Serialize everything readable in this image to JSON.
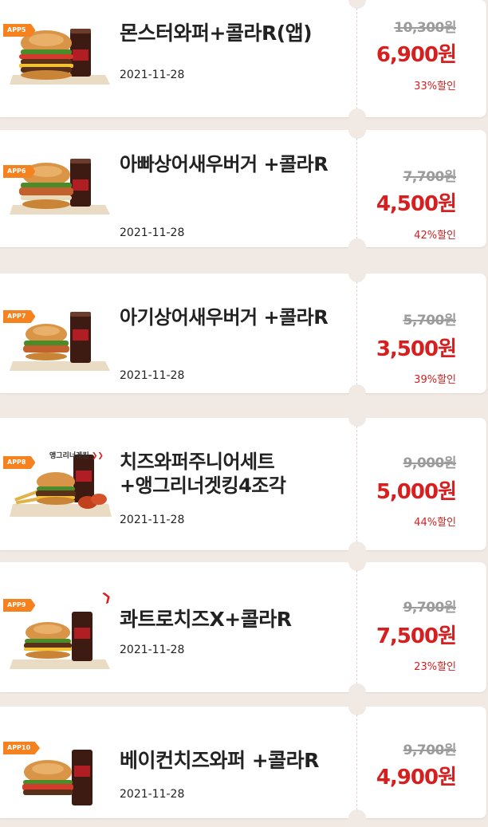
{
  "coupons": [
    {
      "badge": "APP5",
      "promo_tag": "",
      "name": "몬스터와퍼+콜라R(앱)",
      "date": "2021-11-28",
      "original_price": "10,300원",
      "sale_price": "6,900원",
      "discount": "33%할인"
    },
    {
      "badge": "APP6",
      "promo_tag": "",
      "name": "아빠상어새우버거 +콜라R",
      "date": "2021-11-28",
      "original_price": "7,700원",
      "sale_price": "4,500원",
      "discount": "42%할인"
    },
    {
      "badge": "APP7",
      "promo_tag": "",
      "name": "아기상어새우버거 +콜라R",
      "date": "2021-11-28",
      "original_price": "5,700원",
      "sale_price": "3,500원",
      "discount": "39%할인"
    },
    {
      "badge": "APP8",
      "promo_tag": "앵그리너겟킹",
      "name": "치즈와퍼주니어세트 +앵그리너겟킹4조각",
      "date": "2021-11-28",
      "original_price": "9,000원",
      "sale_price": "5,000원",
      "discount": "44%할인"
    },
    {
      "badge": "APP9",
      "promo_tag": "",
      "name": "콰트로치즈X+콜라R",
      "date": "2021-11-28",
      "original_price": "9,700원",
      "sale_price": "7,500원",
      "discount": "23%할인"
    },
    {
      "badge": "APP10",
      "promo_tag": "",
      "name": "베이컨치즈와퍼 +콜라R",
      "date": "2021-11-28",
      "original_price": "9,700원",
      "sale_price": "4,900원",
      "discount": ""
    }
  ],
  "colors": {
    "background": "#f1e9e3",
    "card": "#ffffff",
    "badge": "#f5821f",
    "sale_price": "#d71f1f",
    "discount": "#d71f1f",
    "original_price": "#9b9b9b",
    "title": "#222222"
  },
  "icons": {
    "product_image": "burger-and-cola-image",
    "badge_shape": "arrow-tag",
    "spicy_mark": "chili-pepper-icon"
  }
}
